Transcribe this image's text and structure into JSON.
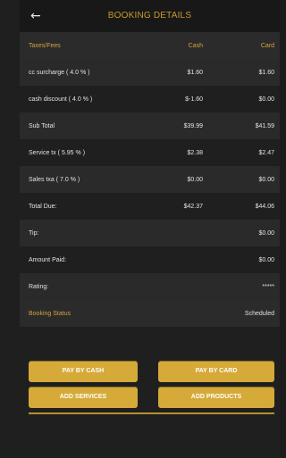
{
  "header": {
    "title": "BOOKING DETAILS",
    "back_icon": "arrow-left-icon"
  },
  "table": {
    "headers": {
      "label": "Taxes/Fees",
      "cash": "Cash",
      "card": "Card"
    },
    "rows": [
      {
        "label": "cc surcharge ( 4.0 % )",
        "cash": "$1.60",
        "card": "$1.60"
      },
      {
        "label": "cash discount ( 4.0 % )",
        "cash": "$-1.60",
        "card": "$0.00"
      },
      {
        "label": "Sub Total",
        "cash": "$39.99",
        "card": "$41.59"
      },
      {
        "label": "Service tx ( 5.95 % )",
        "cash": "$2.38",
        "card": "$2.47"
      },
      {
        "label": "Sales txa ( 7.0 % )",
        "cash": "$0.00",
        "card": "$0.00"
      },
      {
        "label": "Total Due:",
        "cash": "$42.37",
        "card": "$44.06"
      },
      {
        "label": "Tip:",
        "cash": "",
        "card": "$0.00"
      },
      {
        "label": "Amount Paid:",
        "cash": "",
        "card": "$0.00"
      },
      {
        "label": "Rating:",
        "cash": "",
        "card": "*****"
      }
    ],
    "status": {
      "label": "Booking Status",
      "value": "Scheduled"
    }
  },
  "buttons": {
    "pay_cash": "PAY BY CASH",
    "pay_card": "PAY BY CARD",
    "add_services": "ADD SERVICES",
    "add_products": "ADD PRODUCTS"
  },
  "colors": {
    "accent": "#d6aa39",
    "background": "#1f1f1f",
    "header": "#181818"
  }
}
